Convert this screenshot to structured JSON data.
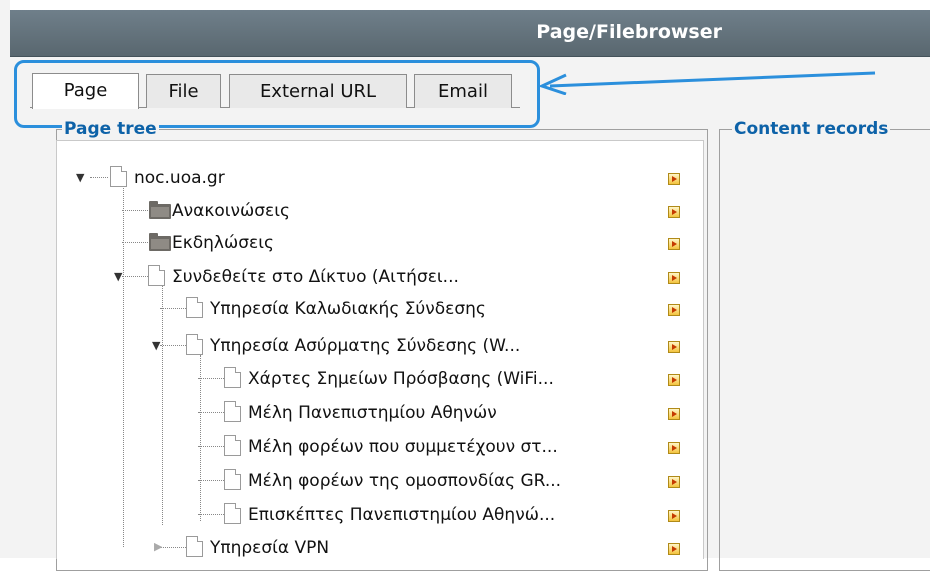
{
  "window": {
    "title": "Page/Filebrowser"
  },
  "tabs": [
    {
      "label": "Page",
      "active": true
    },
    {
      "label": "File",
      "active": false
    },
    {
      "label": "External URL",
      "active": false
    },
    {
      "label": "Email",
      "active": false
    }
  ],
  "page_tree": {
    "legend": "Page tree",
    "items": [
      {
        "label": "noc.uoa.gr",
        "icon": "doc-icon",
        "toggle": "expanded"
      },
      {
        "label": "Ανακοινώσεις",
        "icon": "folder-icon",
        "toggle": "none"
      },
      {
        "label": "Εκδηλώσεις",
        "icon": "folder-icon",
        "toggle": "none"
      },
      {
        "label": "Συνδεθείτε στο Δίκτυο (Αιτήσει...",
        "icon": "doc-icon",
        "toggle": "expanded"
      },
      {
        "label": "Υπηρεσία Καλωδιακής Σύνδεσης",
        "icon": "doc-icon",
        "toggle": "none"
      },
      {
        "label": "Υπηρεσία Ασύρματης Σύνδεσης (W...",
        "icon": "doc-icon",
        "toggle": "expanded"
      },
      {
        "label": "Χάρτες Σημείων Πρόσβασης (WiFi...",
        "icon": "doc-icon",
        "toggle": "none"
      },
      {
        "label": "Μέλη Πανεπιστημίου Αθηνών",
        "icon": "doc-icon",
        "toggle": "none"
      },
      {
        "label": "Μέλη φορέων που συμμετέχουν στ...",
        "icon": "doc-icon",
        "toggle": "none"
      },
      {
        "label": "Μέλη φορέων της ομοσπονδίας GR...",
        "icon": "doc-icon",
        "toggle": "none"
      },
      {
        "label": "Επισκέπτες Πανεπιστημίου Αθηνώ...",
        "icon": "doc-icon",
        "toggle": "none"
      },
      {
        "label": "Υπηρεσία VPN",
        "icon": "doc-icon",
        "toggle": "collapsed"
      }
    ]
  },
  "content_records": {
    "legend": "Content records"
  },
  "colors": {
    "accent": "#2b8fdc",
    "legend": "#0d62a8",
    "titlebar": "#5f6d76"
  }
}
